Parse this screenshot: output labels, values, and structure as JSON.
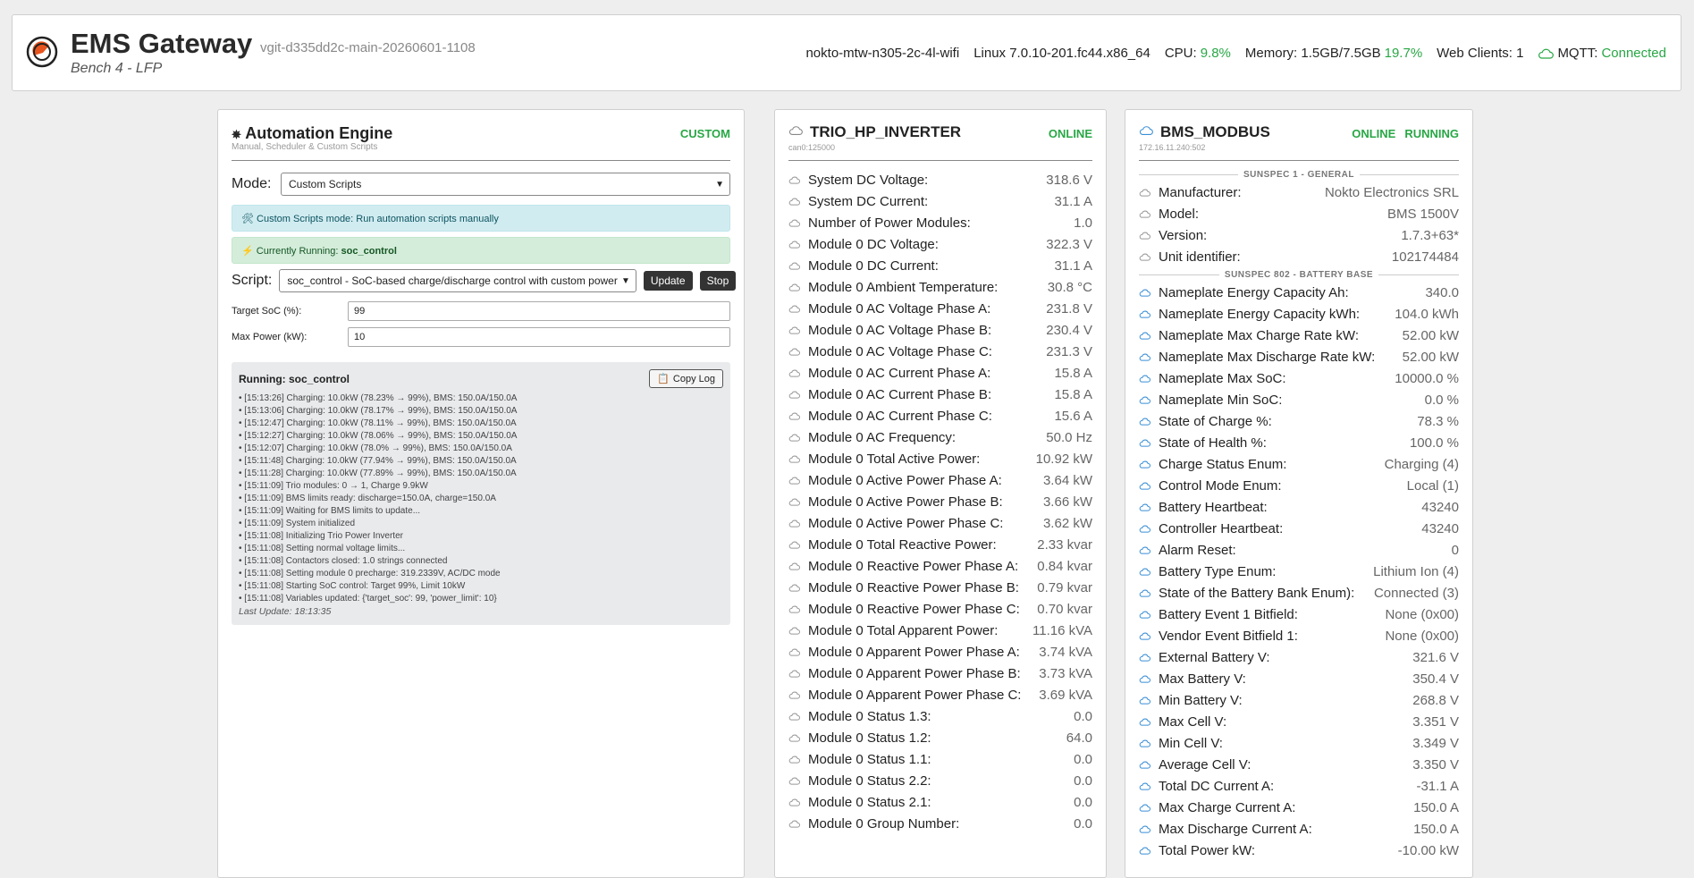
{
  "header": {
    "title": "EMS Gateway",
    "version": "vgit-d335dd2c-main-20260601-1108",
    "subtitle": "Bench 4 - LFP",
    "hostname": "nokto-mtw-n305-2c-4l-wifi",
    "kernel": "Linux 7.0.10-201.fc44.x86_64",
    "cpu_label": "CPU:",
    "cpu_value": "9.8%",
    "memory_label": "Memory: 1.5GB/7.5GB",
    "memory_pct": "19.7%",
    "web_clients": "Web Clients: 1",
    "mqtt_label": "MQTT:",
    "mqtt_status": "Connected"
  },
  "automation": {
    "icon": "gear-icon",
    "title": "Automation Engine",
    "subtitle": "Manual, Scheduler & Custom Scripts",
    "state": "CUSTOM",
    "mode_label": "Mode:",
    "mode_value": "Custom Scripts",
    "info_text": "Custom Scripts mode: Run automation scripts manually",
    "running_prefix": "Currently Running:",
    "running_script": "soc_control",
    "script_label": "Script:",
    "script_value": "soc_control - SoC-based charge/discharge control with custom power",
    "update_label": "Update",
    "stop_label": "Stop",
    "target_soc_label": "Target SoC (%):",
    "target_soc_value": "99",
    "max_power_label": "Max Power (kW):",
    "max_power_value": "10",
    "log_title": "Running: soc_control",
    "copy_log_label": "Copy Log",
    "log_lines": [
      "• [15:13:26] Charging: 10.0kW (78.23% → 99%), BMS: 150.0A/150.0A",
      "• [15:13:06] Charging: 10.0kW (78.17% → 99%), BMS: 150.0A/150.0A",
      "• [15:12:47] Charging: 10.0kW (78.11% → 99%), BMS: 150.0A/150.0A",
      "• [15:12:27] Charging: 10.0kW (78.06% → 99%), BMS: 150.0A/150.0A",
      "• [15:12:07] Charging: 10.0kW (78.0% → 99%), BMS: 150.0A/150.0A",
      "• [15:11:48] Charging: 10.0kW (77.94% → 99%), BMS: 150.0A/150.0A",
      "• [15:11:28] Charging: 10.0kW (77.89% → 99%), BMS: 150.0A/150.0A",
      "• [15:11:09] Trio modules: 0 → 1, Charge 9.9kW",
      "• [15:11:09] BMS limits ready: discharge=150.0A, charge=150.0A",
      "• [15:11:09] Waiting for BMS limits to update...",
      "• [15:11:09] System initialized",
      "• [15:11:08] Initializing Trio Power Inverter",
      "• [15:11:08] Setting normal voltage limits...",
      "• [15:11:08] Contactors closed: 1.0 strings connected",
      "• [15:11:08] Setting module 0 precharge: 319.2339V, AC/DC mode",
      "• [15:11:08] Starting SoC control: Target 99%, Limit 10kW",
      "• [15:11:08] Variables updated: {'target_soc': 99, 'power_limit': 10}"
    ],
    "last_update": "Last Update: 18:13:35"
  },
  "inverter": {
    "icon": "cloud-icon",
    "title": "TRIO_HP_INVERTER",
    "subtitle": "can0:125000",
    "state": "ONLINE",
    "rows": [
      {
        "label": "System DC Voltage:",
        "value": "318.6 V"
      },
      {
        "label": "System DC Current:",
        "value": "31.1 A"
      },
      {
        "label": "Number of Power Modules:",
        "value": "1.0"
      },
      {
        "label": "Module 0 DC Voltage:",
        "value": "322.3 V"
      },
      {
        "label": "Module 0 DC Current:",
        "value": "31.1 A"
      },
      {
        "label": "Module 0 Ambient Temperature:",
        "value": "30.8 °C"
      },
      {
        "label": "Module 0 AC Voltage Phase A:",
        "value": "231.8 V"
      },
      {
        "label": "Module 0 AC Voltage Phase B:",
        "value": "230.4 V"
      },
      {
        "label": "Module 0 AC Voltage Phase C:",
        "value": "231.3 V"
      },
      {
        "label": "Module 0 AC Current Phase A:",
        "value": "15.8 A"
      },
      {
        "label": "Module 0 AC Current Phase B:",
        "value": "15.8 A"
      },
      {
        "label": "Module 0 AC Current Phase C:",
        "value": "15.6 A"
      },
      {
        "label": "Module 0 AC Frequency:",
        "value": "50.0 Hz"
      },
      {
        "label": "Module 0 Total Active Power:",
        "value": "10.92 kW"
      },
      {
        "label": "Module 0 Active Power Phase A:",
        "value": "3.64 kW"
      },
      {
        "label": "Module 0 Active Power Phase B:",
        "value": "3.66 kW"
      },
      {
        "label": "Module 0 Active Power Phase C:",
        "value": "3.62 kW"
      },
      {
        "label": "Module 0 Total Reactive Power:",
        "value": "2.33 kvar"
      },
      {
        "label": "Module 0 Reactive Power Phase A:",
        "value": "0.84 kvar"
      },
      {
        "label": "Module 0 Reactive Power Phase B:",
        "value": "0.79 kvar"
      },
      {
        "label": "Module 0 Reactive Power Phase C:",
        "value": "0.70 kvar"
      },
      {
        "label": "Module 0 Total Apparent Power:",
        "value": "11.16 kVA"
      },
      {
        "label": "Module 0 Apparent Power Phase A:",
        "value": "3.74 kVA"
      },
      {
        "label": "Module 0 Apparent Power Phase B:",
        "value": "3.73 kVA"
      },
      {
        "label": "Module 0 Apparent Power Phase C:",
        "value": "3.69 kVA"
      },
      {
        "label": "Module 0 Status 1.3:",
        "value": "0.0"
      },
      {
        "label": "Module 0 Status 1.2:",
        "value": "64.0"
      },
      {
        "label": "Module 0 Status 1.1:",
        "value": "0.0"
      },
      {
        "label": "Module 0 Status 2.2:",
        "value": "0.0"
      },
      {
        "label": "Module 0 Status 2.1:",
        "value": "0.0"
      },
      {
        "label": "Module 0 Group Number:",
        "value": "0.0"
      }
    ]
  },
  "bms": {
    "icon": "cloud-icon",
    "title": "BMS_MODBUS",
    "subtitle": "172.16.11.240:502",
    "state_online": "ONLINE",
    "state_running": "RUNNING",
    "section1_title": "SUNSPEC 1 - GENERAL",
    "section1_rows": [
      {
        "label": "Manufacturer:",
        "value": "Nokto Electronics SRL"
      },
      {
        "label": "Model:",
        "value": "BMS 1500V"
      },
      {
        "label": "Version:",
        "value": "1.7.3+63*"
      },
      {
        "label": "Unit identifier:",
        "value": "102174484"
      }
    ],
    "section2_title": "SUNSPEC 802 - BATTERY BASE",
    "section2_rows": [
      {
        "label": "Nameplate Energy Capacity Ah:",
        "value": "340.0"
      },
      {
        "label": "Nameplate Energy Capacity kWh:",
        "value": "104.0 kWh"
      },
      {
        "label": "Nameplate Max Charge Rate kW:",
        "value": "52.00 kW"
      },
      {
        "label": "Nameplate Max Discharge Rate kW:",
        "value": "52.00 kW"
      },
      {
        "label": "Nameplate Max SoC:",
        "value": "10000.0 %"
      },
      {
        "label": "Nameplate Min SoC:",
        "value": "0.0 %"
      },
      {
        "label": "State of Charge %:",
        "value": "78.3 %"
      },
      {
        "label": "State of Health %:",
        "value": "100.0 %"
      },
      {
        "label": "Charge Status Enum:",
        "value": "Charging (4)"
      },
      {
        "label": "Control Mode Enum:",
        "value": "Local (1)"
      },
      {
        "label": "Battery Heartbeat:",
        "value": "43240"
      },
      {
        "label": "Controller Heartbeat:",
        "value": "43240"
      },
      {
        "label": "Alarm Reset:",
        "value": "0"
      },
      {
        "label": "Battery Type Enum:",
        "value": "Lithium Ion (4)"
      },
      {
        "label": "State of the Battery Bank Enum):",
        "value": "Connected (3)"
      },
      {
        "label": "Battery Event 1 Bitfield:",
        "value": "None (0x00)"
      },
      {
        "label": "Vendor Event Bitfield 1:",
        "value": "None (0x00)"
      },
      {
        "label": "External Battery V:",
        "value": "321.6 V"
      },
      {
        "label": "Max Battery V:",
        "value": "350.4 V"
      },
      {
        "label": "Min Battery V:",
        "value": "268.8 V"
      },
      {
        "label": "Max Cell V:",
        "value": "3.351 V"
      },
      {
        "label": "Min Cell V:",
        "value": "3.349 V"
      },
      {
        "label": "Average Cell V:",
        "value": "3.350 V"
      },
      {
        "label": "Total DC Current A:",
        "value": "-31.1 A"
      },
      {
        "label": "Max Charge Current A:",
        "value": "150.0 A"
      },
      {
        "label": "Max Discharge Current A:",
        "value": "150.0 A"
      },
      {
        "label": "Total Power kW:",
        "value": "-10.00 kW"
      }
    ]
  }
}
